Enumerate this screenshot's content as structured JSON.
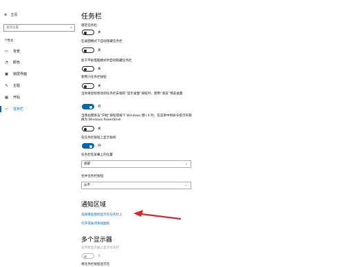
{
  "window": {
    "title": "设置"
  },
  "sidebar": {
    "home": "主页",
    "search_placeholder": "查找设置",
    "section": "个性化",
    "items": [
      {
        "label": "背景",
        "icon": "image-icon"
      },
      {
        "label": "颜色",
        "icon": "palette-icon"
      },
      {
        "label": "锁屏界面",
        "icon": "lock-screen-icon"
      },
      {
        "label": "主题",
        "icon": "theme-icon"
      },
      {
        "label": "开始",
        "icon": "start-icon"
      },
      {
        "label": "任务栏",
        "icon": "taskbar-icon",
        "active": true
      }
    ]
  },
  "main": {
    "title": "任务栏",
    "settings": [
      {
        "label": "锁定任务栏",
        "state": "关",
        "on": false
      },
      {
        "label": "在桌面模式下自动隐藏任务栏",
        "state": "关",
        "on": false
      },
      {
        "label": "处于平板电脑模式时自动隐藏任务栏",
        "state": "关",
        "on": false
      },
      {
        "label": "使用小任务栏按钮",
        "state": "关",
        "on": false
      },
      {
        "label": "当你将鼠标移动到任务栏末端的“显示桌面”按钮时，使用“速览”预览桌面",
        "state": "开",
        "on": true
      },
      {
        "label": "当我右键单击“开始”按钮或按下 Windows 键+X 时，在菜单中将命令提示符替换为 Windows PowerShell",
        "state": "关",
        "on": false
      },
      {
        "label": "在任务栏按钮上显示角标",
        "state": "开",
        "on": true
      }
    ],
    "position_label": "任务栏在屏幕上的位置",
    "position_value": "底部",
    "combine_label": "合并任务栏按钮",
    "combine_value": "从不",
    "notify_title": "通知区域",
    "notify_link1": "选择哪些图标显示在任务栏上",
    "notify_link2": "打开或关闭系统图标",
    "multi_title": "多个显示器",
    "multi_toggle_label": "在所有显示器上显示任务栏",
    "multi_toggle_state": "关",
    "multi_next_label": "将任务栏按钮显示在"
  },
  "colors": {
    "accent": "#0067b8",
    "annotation_arrow": "#d9262b"
  }
}
